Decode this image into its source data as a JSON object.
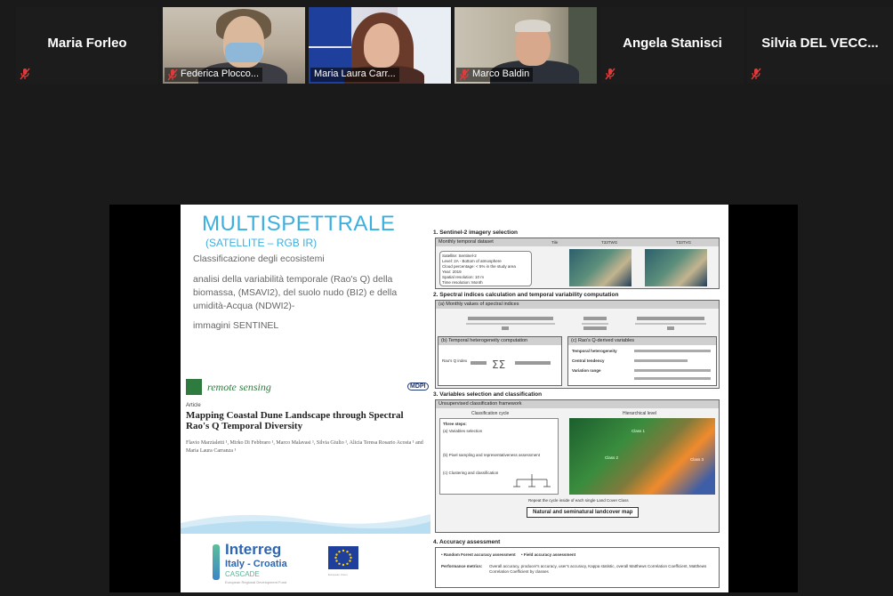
{
  "participants": [
    {
      "name": "Maria Forleo",
      "video": false,
      "muted": true
    },
    {
      "name": "Federica Plocco...",
      "video": true,
      "muted": true
    },
    {
      "name": "Maria Laura Carr...",
      "video": true,
      "muted": false
    },
    {
      "name": "Marco Baldin",
      "video": true,
      "muted": true
    },
    {
      "name": "Angela Stanisci",
      "video": false,
      "muted": true
    },
    {
      "name": "Silvia DEL VECC...",
      "video": false,
      "muted": true
    }
  ],
  "colors": {
    "background": "#1a1a1a",
    "muted_icon": "#e03b3b",
    "slide_title": "#3bb0df"
  },
  "slide": {
    "title": "MULTISPETTRALE",
    "subtitle": "(SATELLITE – RGB IR)",
    "line1": "Classificazione degli ecosistemi",
    "line2": "analisi della variabilità temporale (Rao's Q) della biomassa, (MSAVI2), del suolo nudo (BI2) e della umidità-Acqua (NDWI2)-",
    "line3": "immagini SENTINEL",
    "journal": "remote sensing",
    "publisher": "MDPI",
    "article_type": "Article",
    "article_title": "Mapping Coastal Dune Landscape through Spectral Rao's Q Temporal Diversity",
    "authors": "Flavio Marzialetti ¹, Mirko Di Febbraro ¹, Marco Malavasi ¹, Silvia Giulio ¹, Alicia Teresa Rosario Acosta ¹ and Maria Laura Carranza ¹",
    "interreg_name": "Interreg",
    "interreg_country": "Italy - Croatia",
    "interreg_project": "CASCADE",
    "interreg_fund": "European Regional Development Fund",
    "eu_caption": "European Union",
    "workflow": {
      "s1": "1. Sentinel-2 imagery selection",
      "s1_box": "Monthly temporal dataset",
      "tile_label": "Tile",
      "tile_a": "T33TWG",
      "tile_b": "T33TVG",
      "s1_details": "Satellite: Sentinel-2\nLevel: 2A - Bottom of atmosphere\nCloud percentage: < 5% in the study area\nYear: 2019\nSpatial resolution: 10 m\nTime resolution: Month",
      "s2": "2. Spectral indices calculation and temporal variability computation",
      "s2a": "(a) Monthly values of spectral indices",
      "s2b": "(b) Temporal heterogeneity computation",
      "s2c": "(c) Rao's Q-derived variables",
      "rao_label": "Rao's Q index",
      "c_rows": [
        "Temporal heterogeneity",
        "Central tendency",
        "Variation range"
      ],
      "s3": "3. Variables selection and classification",
      "s3_box": "Unsupervised classification framework",
      "cycle_label": "Classification cycle",
      "hier_label": "Hierarchical level",
      "steps": [
        "Three steps:",
        "(a) Variables selection",
        "(b) Pixel sampling and representativeness assessment",
        "(c) Clustering and classification"
      ],
      "classes": [
        "Class 1",
        "Class 2",
        "Class 3"
      ],
      "repeat_note": "Repeat the cycle inside of each single Land Cover Class",
      "map_label": "Natural and seminatural landcover map",
      "s4": "4. Accuracy assessment",
      "acc1": "• Random Forest accuracy assessment",
      "acc2": "• Field accuracy assessment",
      "perf_label": "Performance metrics:",
      "perf_text": "Overall accuracy, producer's accuracy, user's accuracy, Kappa statistic, overall Matthews Correlation Coefficient, Matthews Correlation Coefficient by classes"
    }
  }
}
